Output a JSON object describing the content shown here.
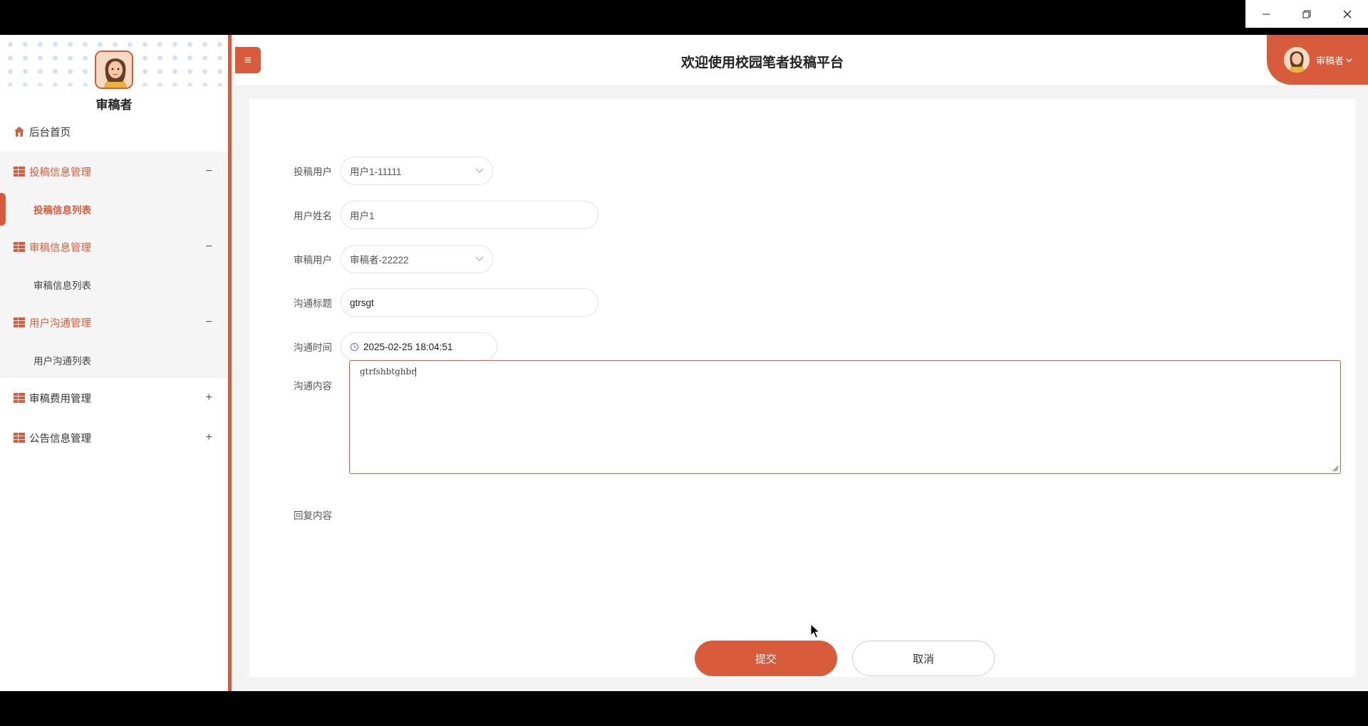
{
  "window": {
    "minimize_icon": "minimize-icon",
    "restore_icon": "restore-icon",
    "close_icon": "close-icon"
  },
  "sidebar": {
    "role": "审稿者",
    "menus": [
      {
        "label": "后台首页",
        "icon": "home-icon"
      },
      {
        "label": "投稿信息管理",
        "icon": "grid-icon",
        "toggle": "−",
        "children": [
          "投稿信息列表"
        ]
      },
      {
        "label": "审稿信息管理",
        "icon": "grid-icon",
        "toggle": "−",
        "children": [
          "审稿信息列表"
        ]
      },
      {
        "label": "用户沟通管理",
        "icon": "grid-icon",
        "toggle": "−",
        "children": [
          "用户沟通列表"
        ]
      },
      {
        "label": "审稿费用管理",
        "icon": "grid-icon",
        "toggle": "+"
      },
      {
        "label": "公告信息管理",
        "icon": "grid-icon",
        "toggle": "+"
      }
    ]
  },
  "header": {
    "menu_icon": "≡",
    "title": "欢迎使用校园笔者投稿平台",
    "user_name": "审稿者"
  },
  "form": {
    "submitter_label": "投稿用户",
    "submitter_value": "用户1-11111",
    "username_label": "用户姓名",
    "username_value": "用户1",
    "reviewer_label": "审稿用户",
    "reviewer_value": "审稿者-22222",
    "subject_label": "沟通标题",
    "subject_value": "gtrsgt",
    "time_label": "沟通时间",
    "time_value": "2025-02-25 18:04:51",
    "content_label": "沟通内容",
    "content_value": "gtrfshbtghbr",
    "reply_label": "回复内容",
    "submit_label": "提交",
    "cancel_label": "取消"
  },
  "colors": {
    "accent": "#d85c3b"
  }
}
